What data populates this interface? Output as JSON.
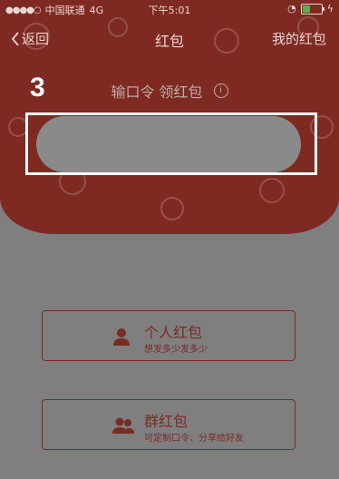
{
  "status": {
    "carrier": "中国联通",
    "network": "4G",
    "time": "下午5:01"
  },
  "nav": {
    "back_label": "返回",
    "title": "红包",
    "right_label": "我的红包"
  },
  "tutorial": {
    "step": "3"
  },
  "password_section": {
    "title": "输口令 领红包",
    "info_symbol": "i"
  },
  "options": [
    {
      "title": "个人红包",
      "subtitle": "想发多少发多少",
      "icon": "person-icon"
    },
    {
      "title": "群红包",
      "subtitle": "可定制口令、分享给好友",
      "icon": "group-icon"
    }
  ],
  "colors": {
    "overlay": "#7f7f7f",
    "panel_red": "#7e2a23",
    "card_border": "#7a2b24",
    "highlight": "#ffffff"
  }
}
